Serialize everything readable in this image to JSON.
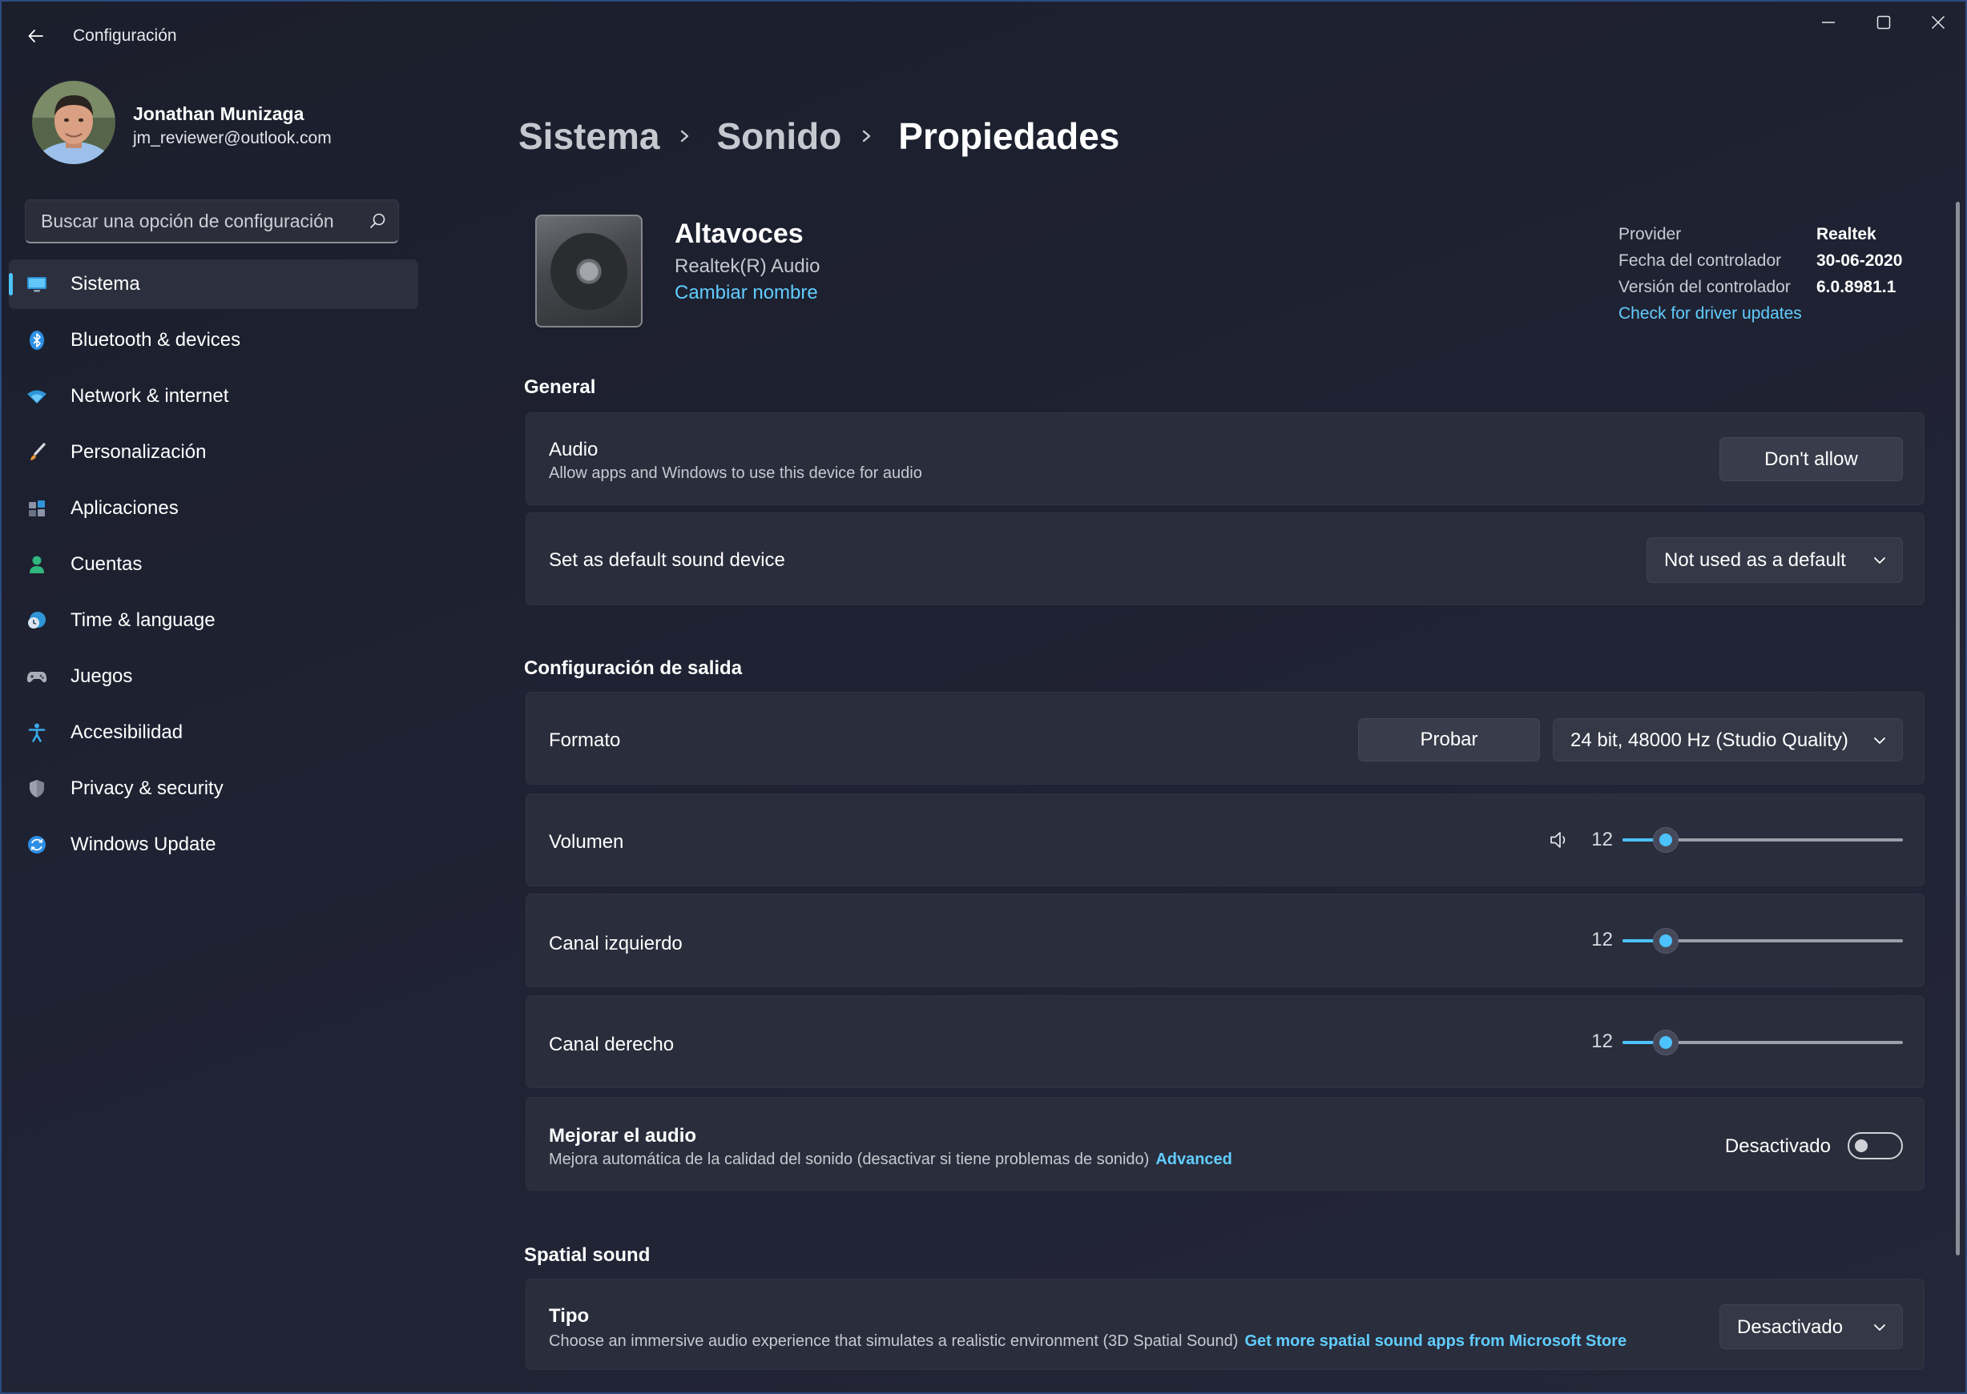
{
  "theme": {
    "accent": "#4cc2ff",
    "link": "#60cdff"
  },
  "window": {
    "title": "Configuración",
    "back_icon": "back-arrow-icon",
    "controls": [
      "minimize-icon",
      "maximize-icon",
      "close-icon"
    ]
  },
  "user": {
    "name": "Jonathan Munizaga",
    "email": "jm_reviewer@outlook.com"
  },
  "search": {
    "placeholder": "Buscar una opción de configuración",
    "icon": "search-icon"
  },
  "sidebar": {
    "selected_index": 0,
    "items": [
      {
        "label": "Sistema",
        "icon": "system-monitor-icon"
      },
      {
        "label": "Bluetooth & devices",
        "icon": "bluetooth-icon"
      },
      {
        "label": "Network & internet",
        "icon": "wifi-icon"
      },
      {
        "label": "Personalización",
        "icon": "paintbrush-icon"
      },
      {
        "label": "Aplicaciones",
        "icon": "apps-icon"
      },
      {
        "label": "Cuentas",
        "icon": "person-icon"
      },
      {
        "label": "Time & language",
        "icon": "globe-clock-icon"
      },
      {
        "label": "Juegos",
        "icon": "gamepad-icon"
      },
      {
        "label": "Accesibilidad",
        "icon": "accessibility-icon"
      },
      {
        "label": "Privacy & security",
        "icon": "shield-icon"
      },
      {
        "label": "Windows Update",
        "icon": "update-icon"
      }
    ]
  },
  "breadcrumb": {
    "items": [
      "Sistema",
      "Sonido",
      "Propiedades"
    ]
  },
  "device": {
    "name": "Altavoces",
    "driver": "Realtek(R) Audio",
    "rename_link": "Cambiar nombre",
    "icon": "speaker-device-icon"
  },
  "driver_info": {
    "rows": [
      {
        "label": "Provider",
        "value": "Realtek"
      },
      {
        "label": "Fecha del controlador",
        "value": "30-06-2020"
      },
      {
        "label": "Versión del controlador",
        "value": "6.0.8981.1"
      }
    ],
    "update_link": "Check for driver updates"
  },
  "general": {
    "heading": "General",
    "audio": {
      "title": "Audio",
      "subtitle": "Allow apps and Windows to use this device for audio",
      "button": "Don't allow"
    },
    "default_device": {
      "title": "Set as default sound device",
      "selected": "Not used as a default"
    }
  },
  "output": {
    "heading": "Configuración de salida",
    "format": {
      "title": "Formato",
      "test_button": "Probar",
      "selected": "24 bit, 48000 Hz (Studio Quality)"
    },
    "volume": {
      "title": "Volumen",
      "value": 12,
      "icon": "speaker-volume-icon"
    },
    "left_channel": {
      "title": "Canal izquierdo",
      "value": 12
    },
    "right_channel": {
      "title": "Canal derecho",
      "value": 12
    },
    "enhance": {
      "title": "Mejorar el audio",
      "subtitle": "Mejora automática de la calidad del sonido (desactivar si tiene problemas de sonido)",
      "link": "Advanced",
      "toggle_label": "Desactivado",
      "enabled": false
    }
  },
  "spatial": {
    "heading": "Spatial sound",
    "type": {
      "title": "Tipo",
      "subtitle": "Choose an immersive audio experience that simulates a realistic environment (3D Spatial Sound)",
      "link": "Get more spatial sound apps from Microsoft Store",
      "selected": "Desactivado"
    }
  }
}
